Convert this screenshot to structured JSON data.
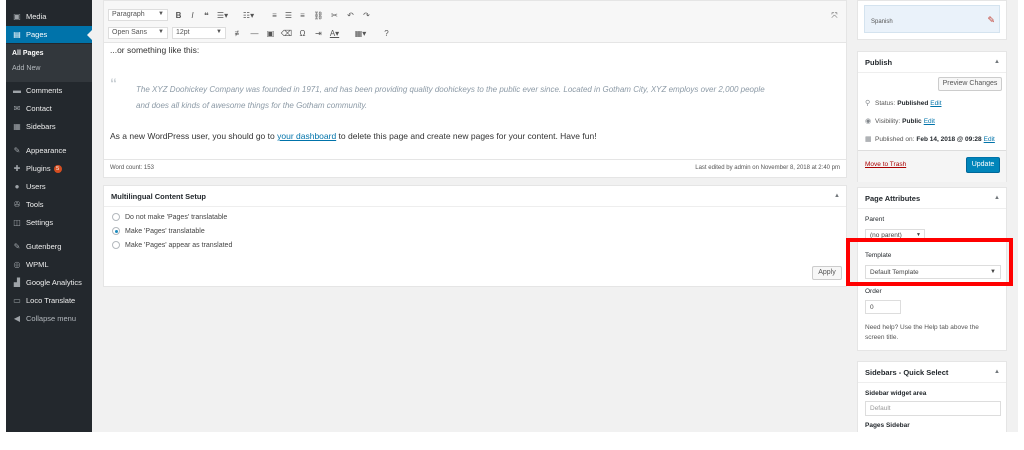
{
  "colors": {
    "sidebar_bg": "#23282d",
    "accent": "#0073aa",
    "highlight": "#ff0000",
    "badge": "#d54e21"
  },
  "sidebar": {
    "items": [
      {
        "label": "Media",
        "icon": "media-icon",
        "glyph": "▣"
      },
      {
        "label": "Pages",
        "icon": "pages-icon",
        "glyph": "▤",
        "active": true
      },
      {
        "label": "Comments",
        "icon": "comments-icon",
        "glyph": "▬"
      },
      {
        "label": "Contact",
        "icon": "contact-icon",
        "glyph": "✉"
      },
      {
        "label": "Sidebars",
        "icon": "sidebars-icon",
        "glyph": "▦"
      },
      {
        "label": "Appearance",
        "icon": "appearance-icon",
        "glyph": "✎"
      },
      {
        "label": "Plugins",
        "icon": "plugins-icon",
        "glyph": "✚",
        "badge": "5"
      },
      {
        "label": "Users",
        "icon": "users-icon",
        "glyph": "●"
      },
      {
        "label": "Tools",
        "icon": "tools-icon",
        "glyph": "✇"
      },
      {
        "label": "Settings",
        "icon": "settings-icon",
        "glyph": "◫"
      },
      {
        "label": "Gutenberg",
        "icon": "gutenberg-icon",
        "glyph": "✎"
      },
      {
        "label": "WPML",
        "icon": "wpml-icon",
        "glyph": "◎"
      },
      {
        "label": "Google Analytics",
        "icon": "analytics-icon",
        "glyph": "▟"
      },
      {
        "label": "Loco Translate",
        "icon": "translate-icon",
        "glyph": "▭"
      },
      {
        "label": "Collapse menu",
        "icon": "collapse-icon",
        "glyph": "◀"
      }
    ],
    "submenu": [
      "All Pages",
      "Add New"
    ]
  },
  "editor": {
    "format_select": "Paragraph",
    "font_select": "Open Sans",
    "size_select": "12pt",
    "intro": "...or something like this:",
    "quote_line1": "The XYZ Doohickey Company was founded in 1971, and has been providing quality doohickeys to the public ever since. Located in Gotham City, XYZ employs over 2,000 people",
    "quote_line2": "and does all kinds of awesome things for the Gotham community.",
    "text_before": "As a new WordPress user, you should go to ",
    "link": "your dashboard",
    "text_after": " to delete this page and create new pages for your content. Have fun!",
    "word_count": "Word count: 153",
    "last_edited": "Last edited by admin on November 8, 2018 at 2:40 pm"
  },
  "multilingual": {
    "title": "Multilingual Content Setup",
    "options": [
      "Do not make 'Pages' translatable",
      "Make 'Pages' translatable",
      "Make 'Pages' appear as translated"
    ],
    "selected_index": 1,
    "apply_label": "Apply"
  },
  "language_box": {
    "value": "Spanish"
  },
  "publish": {
    "title": "Publish",
    "preview_label": "Preview Changes",
    "status_label": "Status:",
    "status_value": "Published",
    "visibility_label": "Visibility:",
    "visibility_value": "Public",
    "published_label": "Published on:",
    "published_value": "Feb 14, 2018 @ 09:28",
    "edit_label": "Edit",
    "trash_label": "Move to Trash",
    "update_label": "Update"
  },
  "page_attributes": {
    "title": "Page Attributes",
    "parent_label": "Parent",
    "parent_value": "(no parent)",
    "template_label": "Template",
    "template_value": "Default Template",
    "order_label": "Order",
    "order_value": "0",
    "help_line1": "Need help? Use the Help tab above the",
    "help_line2": "screen title."
  },
  "sidebars_box": {
    "title": "Sidebars - Quick Select",
    "widget_label": "Sidebar widget area",
    "widget_placeholder": "Default",
    "pages_label": "Pages Sidebar"
  }
}
